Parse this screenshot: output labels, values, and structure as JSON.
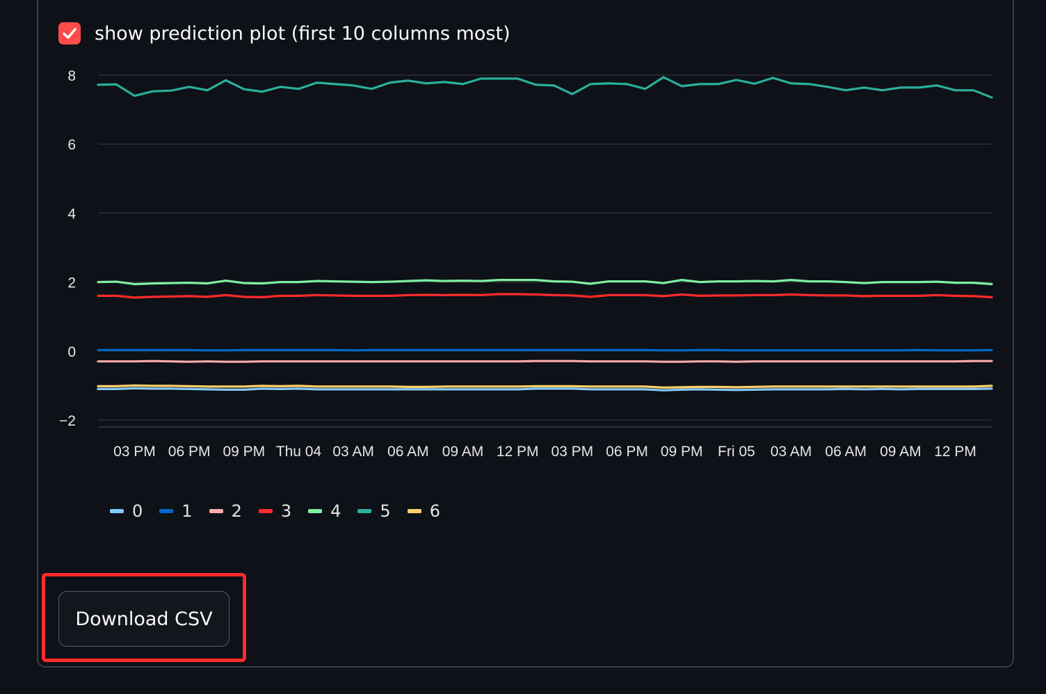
{
  "checkbox": {
    "checked": true,
    "label": "show prediction plot (first 10 columns most)"
  },
  "download_button": {
    "label": "Download CSV"
  },
  "colors": {
    "background": "#0e1117",
    "accent": "#ff4b4b",
    "highlight": "#ff2b2b",
    "grid": "#2c2f36",
    "axis_text": "#e6e6e6"
  },
  "chart_data": {
    "type": "line",
    "title": "",
    "xlabel": "",
    "ylabel": "",
    "ylim": [
      -2.2,
      8.2
    ],
    "y_ticks": [
      8,
      6,
      4,
      2,
      0,
      -2
    ],
    "y_tick_labels": [
      "8",
      "6",
      "4",
      "2",
      "0",
      "−2"
    ],
    "x_tick_labels": [
      "03 PM",
      "06 PM",
      "09 PM",
      "Thu 04",
      "03 AM",
      "06 AM",
      "09 AM",
      "12 PM",
      "03 PM",
      "06 PM",
      "09 PM",
      "Fri 05",
      "03 AM",
      "06 AM",
      "09 AM",
      "12 PM"
    ],
    "x_hours_range": [
      0,
      49
    ],
    "x_tick_hours": [
      2,
      5,
      8,
      11,
      14,
      17,
      20,
      23,
      26,
      29,
      32,
      35,
      38,
      41,
      44,
      47
    ],
    "grid": true,
    "legend_position": "bottom-left",
    "series": [
      {
        "name": "0",
        "color": "#83c9ff",
        "values": [
          -1.1,
          -1.1,
          -1.08,
          -1.09,
          -1.09,
          -1.1,
          -1.11,
          -1.12,
          -1.12,
          -1.09,
          -1.1,
          -1.09,
          -1.11,
          -1.11,
          -1.11,
          -1.11,
          -1.11,
          -1.11,
          -1.11,
          -1.11,
          -1.11,
          -1.11,
          -1.11,
          -1.11,
          -1.09,
          -1.09,
          -1.09,
          -1.11,
          -1.11,
          -1.11,
          -1.11,
          -1.14,
          -1.12,
          -1.11,
          -1.12,
          -1.13,
          -1.12,
          -1.11,
          -1.11,
          -1.11,
          -1.11,
          -1.1,
          -1.11,
          -1.1,
          -1.11,
          -1.1,
          -1.1,
          -1.1,
          -1.1,
          -1.09
        ]
      },
      {
        "name": "1",
        "color": "#0068c9",
        "values": [
          0.03,
          0.03,
          0.03,
          0.03,
          0.03,
          0.03,
          0.02,
          0.02,
          0.03,
          0.03,
          0.03,
          0.03,
          0.03,
          0.03,
          0.02,
          0.03,
          0.03,
          0.03,
          0.03,
          0.03,
          0.03,
          0.03,
          0.03,
          0.03,
          0.03,
          0.03,
          0.03,
          0.03,
          0.03,
          0.03,
          0.03,
          0.02,
          0.02,
          0.03,
          0.03,
          0.02,
          0.02,
          0.02,
          0.02,
          0.02,
          0.02,
          0.02,
          0.02,
          0.02,
          0.02,
          0.03,
          0.02,
          0.02,
          0.02,
          0.03
        ]
      },
      {
        "name": "2",
        "color": "#ffabab",
        "values": [
          -0.3,
          -0.3,
          -0.3,
          -0.29,
          -0.3,
          -0.31,
          -0.3,
          -0.31,
          -0.31,
          -0.3,
          -0.3,
          -0.3,
          -0.3,
          -0.3,
          -0.3,
          -0.3,
          -0.3,
          -0.3,
          -0.3,
          -0.3,
          -0.3,
          -0.3,
          -0.3,
          -0.3,
          -0.29,
          -0.29,
          -0.29,
          -0.3,
          -0.3,
          -0.3,
          -0.3,
          -0.31,
          -0.31,
          -0.3,
          -0.3,
          -0.31,
          -0.3,
          -0.3,
          -0.3,
          -0.3,
          -0.3,
          -0.3,
          -0.3,
          -0.3,
          -0.3,
          -0.3,
          -0.3,
          -0.3,
          -0.29,
          -0.29
        ]
      },
      {
        "name": "3",
        "color": "#ff2b2b",
        "values": [
          1.6,
          1.6,
          1.55,
          1.57,
          1.58,
          1.59,
          1.57,
          1.62,
          1.57,
          1.56,
          1.6,
          1.6,
          1.62,
          1.61,
          1.6,
          1.6,
          1.6,
          1.62,
          1.63,
          1.62,
          1.63,
          1.62,
          1.65,
          1.65,
          1.64,
          1.62,
          1.61,
          1.57,
          1.62,
          1.62,
          1.62,
          1.59,
          1.64,
          1.6,
          1.61,
          1.61,
          1.62,
          1.62,
          1.64,
          1.62,
          1.61,
          1.61,
          1.59,
          1.6,
          1.6,
          1.6,
          1.62,
          1.6,
          1.59,
          1.56
        ]
      },
      {
        "name": "4",
        "color": "#7defa1",
        "values": [
          2.0,
          2.01,
          1.94,
          1.96,
          1.97,
          1.98,
          1.96,
          2.04,
          1.97,
          1.96,
          2.0,
          2.0,
          2.03,
          2.02,
          2.01,
          2.0,
          2.01,
          2.03,
          2.05,
          2.03,
          2.04,
          2.03,
          2.06,
          2.06,
          2.06,
          2.02,
          2.01,
          1.95,
          2.02,
          2.02,
          2.02,
          1.97,
          2.06,
          2.0,
          2.02,
          2.02,
          2.03,
          2.02,
          2.06,
          2.02,
          2.02,
          2.0,
          1.97,
          2.0,
          2.0,
          2.0,
          2.01,
          1.98,
          1.98,
          1.94
        ]
      },
      {
        "name": "5",
        "color": "#29b09d",
        "values": [
          7.72,
          7.73,
          7.4,
          7.53,
          7.55,
          7.66,
          7.56,
          7.85,
          7.59,
          7.52,
          7.66,
          7.6,
          7.78,
          7.74,
          7.7,
          7.6,
          7.78,
          7.84,
          7.76,
          7.8,
          7.74,
          7.9,
          7.9,
          7.9,
          7.72,
          7.7,
          7.45,
          7.74,
          7.76,
          7.74,
          7.6,
          7.94,
          7.68,
          7.74,
          7.74,
          7.86,
          7.75,
          7.92,
          7.76,
          7.74,
          7.66,
          7.56,
          7.64,
          7.56,
          7.64,
          7.64,
          7.7,
          7.56,
          7.56,
          7.35
        ]
      },
      {
        "name": "6",
        "color": "#ffd16a",
        "values": [
          -1.02,
          -1.02,
          -1.0,
          -1.01,
          -1.01,
          -1.02,
          -1.03,
          -1.03,
          -1.03,
          -1.01,
          -1.02,
          -1.01,
          -1.03,
          -1.03,
          -1.03,
          -1.03,
          -1.03,
          -1.04,
          -1.04,
          -1.03,
          -1.03,
          -1.03,
          -1.03,
          -1.03,
          -1.02,
          -1.02,
          -1.02,
          -1.03,
          -1.03,
          -1.03,
          -1.03,
          -1.06,
          -1.05,
          -1.04,
          -1.04,
          -1.05,
          -1.04,
          -1.03,
          -1.03,
          -1.03,
          -1.03,
          -1.03,
          -1.03,
          -1.03,
          -1.03,
          -1.03,
          -1.03,
          -1.03,
          -1.03,
          -1.01
        ]
      }
    ]
  }
}
